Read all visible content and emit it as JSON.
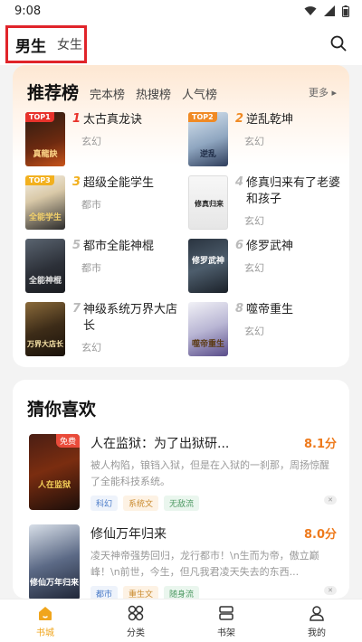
{
  "status_bar": {
    "time": "9:08"
  },
  "header": {
    "tab_male": "男生",
    "tab_female": "女生"
  },
  "ranking": {
    "title": "推荐榜",
    "tabs": [
      "完本榜",
      "热搜榜",
      "人气榜"
    ],
    "more": "更多 ▸",
    "books": [
      {
        "rank": "1",
        "name": "太古真龙诀",
        "genre": "玄幻",
        "badge": "TOP1",
        "cover_text": "真龍訣"
      },
      {
        "rank": "2",
        "name": "逆乱乾坤",
        "genre": "玄幻",
        "badge": "TOP2",
        "cover_text": "逆乱"
      },
      {
        "rank": "3",
        "name": "超级全能学生",
        "genre": "都市",
        "badge": "TOP3",
        "cover_text": "全能学生"
      },
      {
        "rank": "4",
        "name": "修真归来有了老婆和孩子",
        "genre": "玄幻",
        "badge": "",
        "cover_text": "修真归来"
      },
      {
        "rank": "5",
        "name": "都市全能神棍",
        "genre": "都市",
        "badge": "",
        "cover_text": "全能神棍"
      },
      {
        "rank": "6",
        "name": "修罗武神",
        "genre": "玄幻",
        "badge": "",
        "cover_text": "修罗武神"
      },
      {
        "rank": "7",
        "name": "神级系统万界大店长",
        "genre": "玄幻",
        "badge": "",
        "cover_text": "万界大店长"
      },
      {
        "rank": "8",
        "name": "噬帝重生",
        "genre": "玄幻",
        "badge": "",
        "cover_text": "噬帝重生"
      }
    ]
  },
  "guess": {
    "title": "猜你喜欢",
    "items": [
      {
        "title": "人在监狱：为了出狱研...",
        "score": "8.1分",
        "desc": "被人构陷，锒铛入狱，但是在入狱的一刹那，周扬惊醒了全能科技系统。",
        "tags": [
          "科幻",
          "系统文",
          "无敌流"
        ],
        "badge": "免费",
        "cover_text": "人在监狱"
      },
      {
        "title": "修仙万年归来",
        "score": "8.0分",
        "desc": "凌天神帝强势回归，龙行都市！\\n生而为帝，傲立巅峰！\\n前世，今生，但凡我君凌天失去的东西...",
        "tags": [
          "都市",
          "重生文",
          "随身流"
        ],
        "badge": "",
        "cover_text": "修仙万年归来"
      }
    ]
  },
  "nav": {
    "items": [
      "书城",
      "分类",
      "书架",
      "我的"
    ]
  },
  "colors": {
    "accent": "#f0a51c",
    "score": "#ee7a1c",
    "highlight_box": "#e0242a"
  }
}
